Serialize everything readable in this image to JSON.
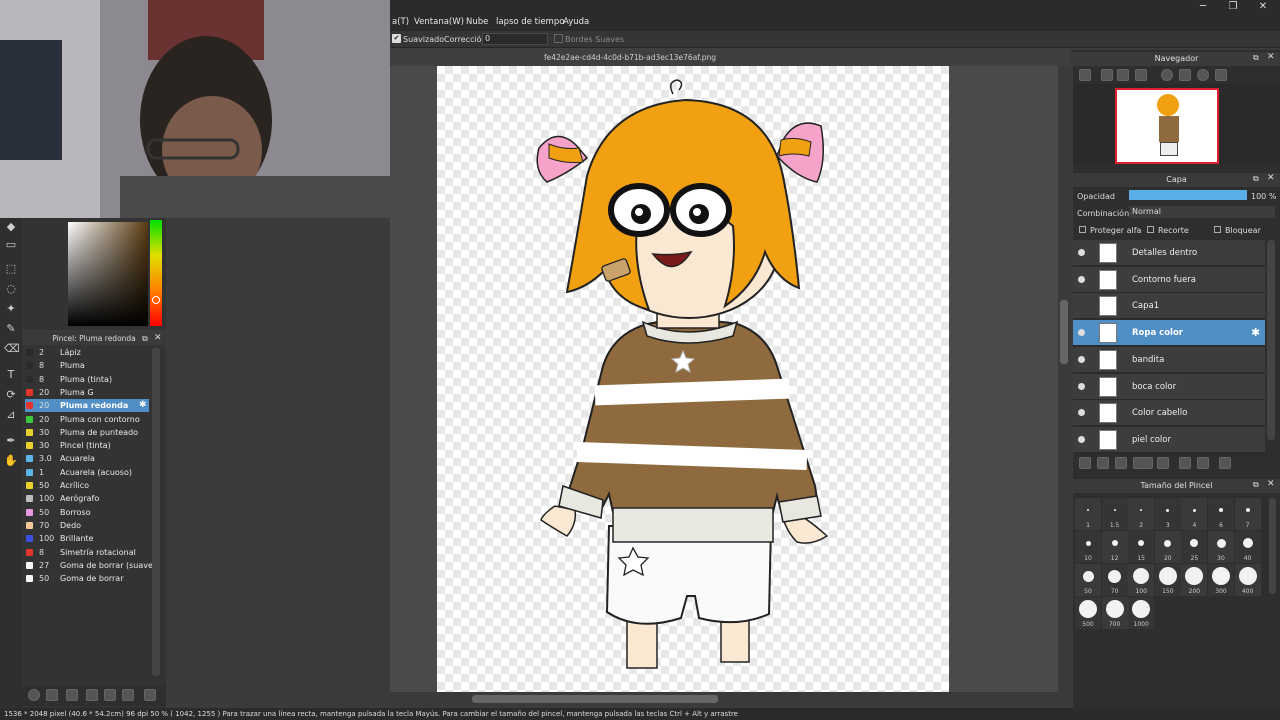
{
  "menu": [
    "a(T)",
    "Ventana(W)",
    "Nube",
    "lapso de tiempo",
    "Ayuda"
  ],
  "window_controls": [
    "─",
    "❐",
    "✕"
  ],
  "tool_options": {
    "smoothing_label": "Suavizado",
    "correction_label": "Corrección",
    "correction_value": "0",
    "soft_edges_label": "Bordes Suaves"
  },
  "document": {
    "filename": "fe42e2ae-cd4d-4c0d-b71b-ad3ec13e76af.png"
  },
  "brush_panel": {
    "title": "Pincel: Pluma redonda",
    "brushes": [
      {
        "size": "2",
        "name": "Lápiz",
        "color": "#2a2a2a"
      },
      {
        "size": "8",
        "name": "Pluma",
        "color": "#2a2a2a"
      },
      {
        "size": "8",
        "name": "Pluma (tinta)",
        "color": "#2a2a2a"
      },
      {
        "size": "20",
        "name": "Pluma G",
        "color": "#e0342c"
      },
      {
        "size": "20",
        "name": "Pluma redonda",
        "color": "#e0342c",
        "selected": true
      },
      {
        "size": "20",
        "name": "Pluma con contorno",
        "color": "#3cc83c"
      },
      {
        "size": "30",
        "name": "Pluma de punteado",
        "color": "#e8d02a"
      },
      {
        "size": "30",
        "name": "Pincel (tinta)",
        "color": "#e8d02a"
      },
      {
        "size": "3.0",
        "name": "Acuarela",
        "color": "#5ab4e6"
      },
      {
        "size": "1",
        "name": "Acuarela (acuoso)",
        "color": "#5ab4e6"
      },
      {
        "size": "50",
        "name": "Acrílico",
        "color": "#e8d02a"
      },
      {
        "size": "100",
        "name": "Aerógrafo",
        "color": "#bdbdbd"
      },
      {
        "size": "50",
        "name": "Borroso",
        "color": "#e89ae0"
      },
      {
        "size": "70",
        "name": "Dedo",
        "color": "#f2c89a"
      },
      {
        "size": "100",
        "name": "Brillante",
        "color": "#3c50e0"
      },
      {
        "size": "8",
        "name": "Simetría rotacional",
        "color": "#e0342c"
      },
      {
        "size": "27",
        "name": "Goma de borrar (suave)",
        "color": "#f5f5f5"
      },
      {
        "size": "50",
        "name": "Goma de borrar",
        "color": "#f5f5f5"
      }
    ]
  },
  "navigator": {
    "title": "Navegador"
  },
  "layers": {
    "title": "Capa",
    "opacity_label": "Opacidad",
    "opacity_value": "100 %",
    "opacity": 1.0,
    "blend_label": "Combinación",
    "blend_value": "Normal",
    "protect_alpha": "Proteger alfa",
    "clipping": "Recorte",
    "lock": "Bloquear",
    "items": [
      {
        "name": "Detalles dentro",
        "visible": true
      },
      {
        "name": "Contorno fuera",
        "visible": true
      },
      {
        "name": "Capa1",
        "visible": false
      },
      {
        "name": "Ropa color",
        "visible": true,
        "selected": true
      },
      {
        "name": "bandita",
        "visible": true
      },
      {
        "name": "boca color",
        "visible": true
      },
      {
        "name": "Color cabello",
        "visible": true
      },
      {
        "name": "piel color",
        "visible": true
      }
    ]
  },
  "brush_size": {
    "title": "Tamaño del Pincel",
    "sizes": [
      "1",
      "1.5",
      "2",
      "3",
      "4",
      "6",
      "7",
      "10",
      "12",
      "15",
      "20",
      "25",
      "30",
      "40",
      "50",
      "70",
      "100",
      "150",
      "200",
      "300",
      "400",
      "500",
      "700",
      "1000"
    ]
  },
  "status": {
    "text": "1536 * 2048 pixel   (40.6 * 54.2cm)   96 dpi   50 %   ( 1042, 1255 )   Para trazar una línea recta, mantenga pulsada la tecla Mayús. Para cambiar el tamaño del pincel, mantenga pulsada las teclas Ctrl + Alt y arrastre"
  },
  "colors": {
    "accent": "#4f8fc6",
    "hair": "#f0a010",
    "sweater": "#8e6a3e",
    "ribbon": "#f5a3c8"
  }
}
